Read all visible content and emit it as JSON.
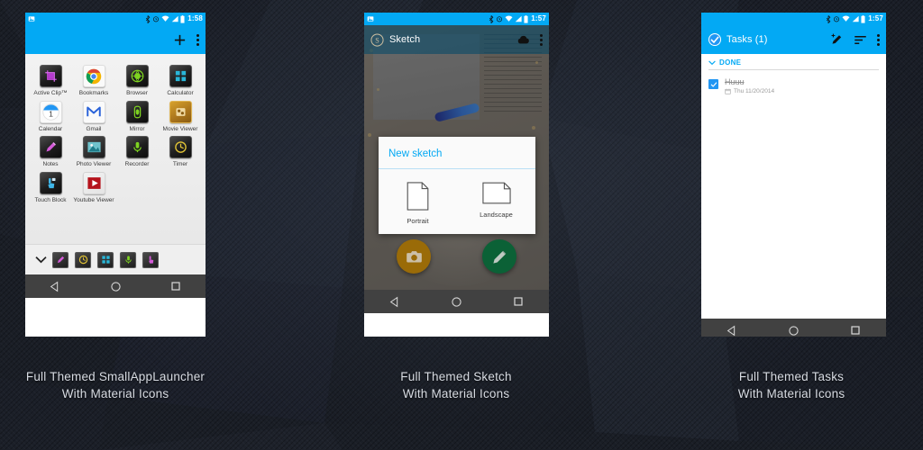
{
  "background": {
    "color": "#1a1e26",
    "style": "dark-polygonal-texture"
  },
  "theme": {
    "accent": "#03A9F4",
    "navbar": "#414141",
    "statusbar": "#03A9F4"
  },
  "phones": [
    {
      "id": "smallapplauncher",
      "statusbar": {
        "left_icon": "image-icon",
        "icons": [
          "bluetooth-icon",
          "alarm-icon",
          "wifi-icon",
          "signal-icon",
          "battery-icon"
        ],
        "clock": "1:58"
      },
      "appbar": {
        "title": "",
        "add_label": "+",
        "actions": [
          "add-icon",
          "overflow-menu-icon"
        ]
      },
      "apps": [
        {
          "label": "Active Clip™",
          "icon": "active-clip-icon",
          "tile": "dark"
        },
        {
          "label": "Bookmarks",
          "icon": "chrome-icon",
          "tile": "white"
        },
        {
          "label": "Browser",
          "icon": "browser-icon",
          "tile": "dark"
        },
        {
          "label": "Calculator",
          "icon": "calculator-icon",
          "tile": "dark"
        },
        {
          "label": "Calendar",
          "icon": "calendar-icon",
          "tile": "white"
        },
        {
          "label": "Gmail",
          "icon": "gmail-icon",
          "tile": "white"
        },
        {
          "label": "Mirror",
          "icon": "mirror-icon",
          "tile": "dark"
        },
        {
          "label": "Movie Viewer",
          "icon": "movie-viewer-icon",
          "tile": "gold"
        },
        {
          "label": "Notes",
          "icon": "notes-icon",
          "tile": "dark"
        },
        {
          "label": "Photo Viewer",
          "icon": "photo-viewer-icon",
          "tile": "teal"
        },
        {
          "label": "Recorder",
          "icon": "recorder-icon",
          "tile": "dark"
        },
        {
          "label": "Timer",
          "icon": "timer-icon",
          "tile": "dark"
        },
        {
          "label": "Touch Block",
          "icon": "touch-block-icon",
          "tile": "dark"
        },
        {
          "label": "Youtube Viewer",
          "icon": "youtube-icon",
          "tile": "red"
        }
      ],
      "dock": {
        "expand_icon": "chevron-down-icon",
        "items": [
          "notes-icon",
          "timer-icon",
          "calculator-icon",
          "recorder-icon",
          "touch-block-icon"
        ]
      },
      "navbar": [
        "back-icon",
        "home-icon",
        "recents-icon"
      ]
    },
    {
      "id": "sketch",
      "statusbar": {
        "left_icon": "image-icon",
        "icons": [
          "bluetooth-icon",
          "alarm-icon",
          "wifi-icon",
          "signal-icon",
          "battery-icon"
        ],
        "clock": "1:57"
      },
      "appbar": {
        "title": "Sketch",
        "logo": "sketch-logo-icon",
        "actions": [
          "cloud-icon",
          "overflow-menu-icon"
        ]
      },
      "dialog": {
        "title": "New sketch",
        "options": [
          {
            "label": "Portrait",
            "icon": "portrait-page-icon"
          },
          {
            "label": "Landscape",
            "icon": "landscape-page-icon"
          }
        ]
      },
      "fabs": [
        {
          "name": "camera-fab",
          "icon": "camera-icon",
          "color": "#9a6b08"
        },
        {
          "name": "draw-fab",
          "icon": "pencil-icon",
          "color": "#0b6136"
        }
      ],
      "navbar": [
        "back-icon",
        "home-icon",
        "recents-icon"
      ]
    },
    {
      "id": "tasks",
      "statusbar": {
        "icons": [
          "bluetooth-icon",
          "alarm-icon",
          "wifi-icon",
          "signal-icon",
          "battery-icon"
        ],
        "clock": "1:57"
      },
      "appbar": {
        "title": "Tasks (1)",
        "logo": "check-circle-icon",
        "actions": [
          "add-task-icon",
          "sort-icon",
          "overflow-menu-icon"
        ]
      },
      "section": {
        "label": "DONE",
        "collapse_icon": "chevron-down-icon"
      },
      "tasks": [
        {
          "title": "Huuu",
          "date": "Thu 11/20/2014",
          "checked": true,
          "date_icon": "calendar-icon"
        }
      ],
      "navbar": [
        "back-icon",
        "home-icon",
        "recents-icon"
      ]
    }
  ],
  "captions": [
    {
      "line1": "Full Themed SmallAppLauncher",
      "line2": "With Material Icons"
    },
    {
      "line1": "Full Themed Sketch",
      "line2": "With Material Icons"
    },
    {
      "line1": "Full Themed Tasks",
      "line2": "With Material Icons"
    }
  ]
}
